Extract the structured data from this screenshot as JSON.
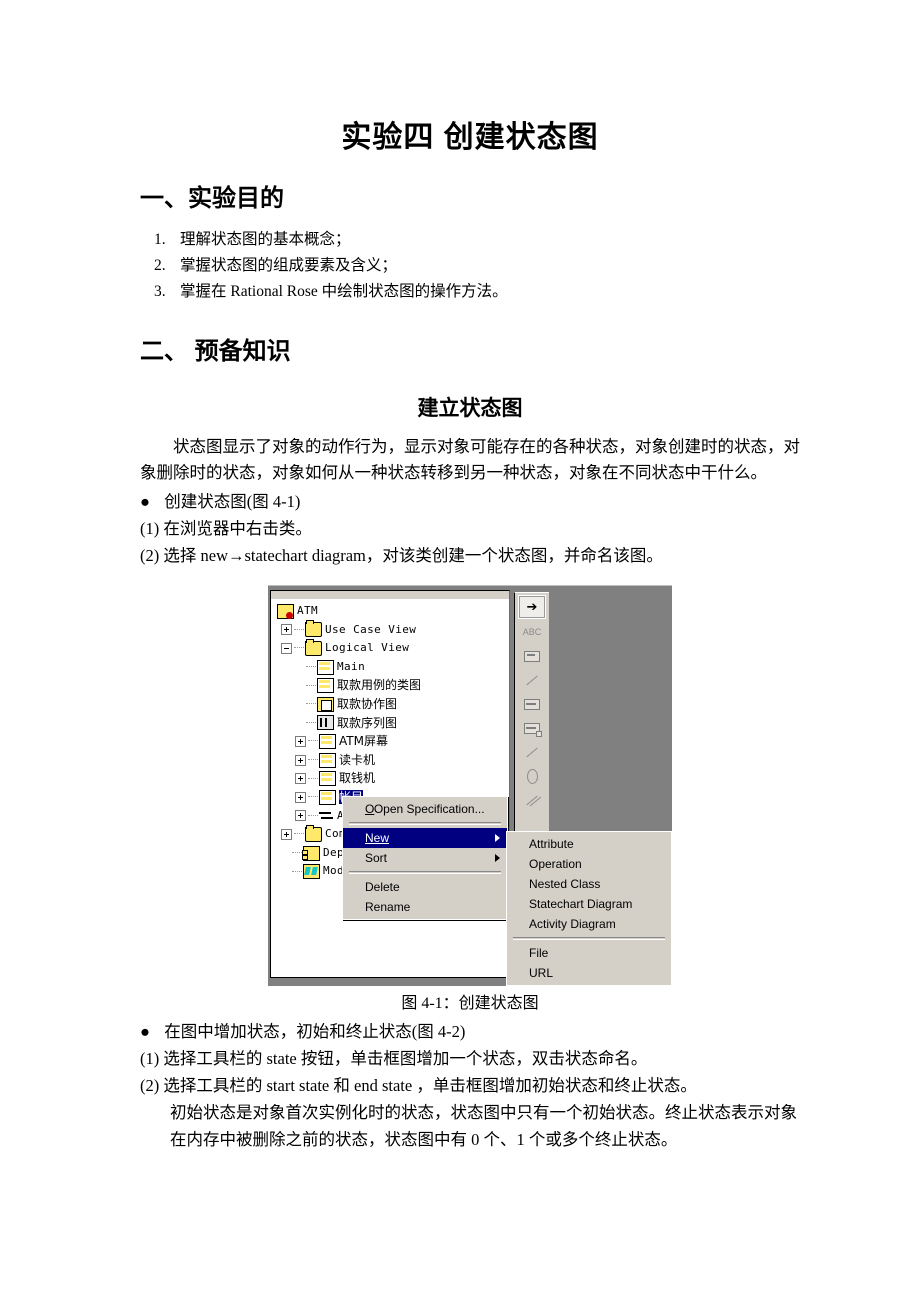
{
  "document": {
    "title": "实验四  创建状态图",
    "sections": [
      {
        "heading": "一、实验目的"
      },
      {
        "heading": "二、 预备知识"
      }
    ],
    "objectives": [
      {
        "num": "1.",
        "text": "理解状态图的基本概念；"
      },
      {
        "num": "2.",
        "text": "掌握状态图的组成要素及含义；"
      },
      {
        "num": "3.",
        "text": "掌握在 Rational Rose 中绘制状态图的操作方法。"
      }
    ],
    "subheading": "建立状态图",
    "paragraph": "状态图显示了对象的动作行为，显示对象可能存在的各种状态，对象创建时的状态，对象删除时的状态，对象如何从一种状态转移到另一种状态，对象在不同状态中干什么。",
    "bullet1": "创建状态图(图 4-1)",
    "step1_1": "(1) 在浏览器中右击类。",
    "step1_2": "(2) 选择 new→statechart diagram，对该类创建一个状态图，并命名该图。",
    "figure_caption": "图 4-1：创建状态图",
    "bullet2": "在图中增加状态，初始和终止状态(图 4-2)",
    "step2_1": "(1) 选择工具栏的 state 按钮，单击框图增加一个状态，双击状态命名。",
    "step2_2": "(2) 选择工具栏的 start state  和 end state  ，单击框图增加初始状态和终止状态。",
    "step2_2_cont": "初始状态是对象首次实例化时的状态，状态图中只有一个初始状态。终止状态表示对象在内存中被删除之前的状态，状态图中有 0 个、1 个或多个终止状态。"
  },
  "screenshot": {
    "tree": [
      {
        "label": "ATM",
        "depth": 0,
        "icon": "model-root-icon",
        "expander": "none",
        "cjk": false
      },
      {
        "label": "Use Case View",
        "depth": 1,
        "icon": "folder-icon",
        "expander": "plus",
        "cjk": false
      },
      {
        "label": "Logical View",
        "depth": 1,
        "icon": "folder-icon",
        "expander": "minus",
        "cjk": false
      },
      {
        "label": "Main",
        "depth": 2,
        "icon": "class-diagram-icon",
        "expander": "none",
        "cjk": false
      },
      {
        "label": "取款用例的类图",
        "depth": 2,
        "icon": "class-diagram-icon",
        "expander": "none",
        "cjk": true
      },
      {
        "label": "取款协作图",
        "depth": 2,
        "icon": "collaboration-diagram-icon",
        "expander": "none",
        "cjk": true
      },
      {
        "label": "取款序列图",
        "depth": 2,
        "icon": "sequence-diagram-icon",
        "expander": "none",
        "cjk": true
      },
      {
        "label": "ATM屏幕",
        "depth": 2,
        "icon": "class-icon",
        "expander": "plus",
        "cjk": true
      },
      {
        "label": "读卡机",
        "depth": 2,
        "icon": "class-icon",
        "expander": "plus",
        "cjk": true
      },
      {
        "label": "取钱机",
        "depth": 2,
        "icon": "class-icon",
        "expander": "plus",
        "cjk": true
      },
      {
        "label": "帐目",
        "depth": 2,
        "icon": "class-icon",
        "expander": "plus",
        "cjk": true,
        "selected": true
      },
      {
        "label": "A",
        "depth": 2,
        "icon": "association-icon",
        "expander": "plus",
        "cjk": false
      },
      {
        "label": "Comp",
        "depth": 1,
        "icon": "folder-icon",
        "expander": "plus",
        "cjk": false
      },
      {
        "label": "Depl",
        "depth": 1,
        "icon": "component-icon",
        "expander": "none",
        "cjk": false
      },
      {
        "label": "Mode",
        "depth": 1,
        "icon": "model-properties-icon",
        "expander": "none",
        "cjk": false
      }
    ],
    "toolbox": [
      {
        "name": "selection-tool",
        "glyph": "arrow",
        "active": true
      },
      {
        "name": "text-tool",
        "glyph": "ABC",
        "active": false
      },
      {
        "name": "note-tool",
        "glyph": "note",
        "active": false
      },
      {
        "name": "anchor-note-tool",
        "glyph": "line",
        "active": false
      },
      {
        "name": "state-tool",
        "glyph": "state",
        "active": false
      },
      {
        "name": "activity-tool",
        "glyph": "activity",
        "active": false
      },
      {
        "name": "transition-tool",
        "glyph": "line",
        "active": false
      },
      {
        "name": "start-state-tool",
        "glyph": "oval",
        "active": false
      },
      {
        "name": "end-state-tool",
        "glyph": "line2",
        "active": false
      }
    ],
    "context_menu": {
      "items": [
        {
          "label": "Open Specification...",
          "mnemonic": 0,
          "submenu": false,
          "highlighted": false
        },
        {
          "separator": true
        },
        {
          "label": "New",
          "mnemonic": 0,
          "submenu": true,
          "highlighted": true
        },
        {
          "label": "Sort",
          "mnemonic": 3,
          "submenu": true,
          "highlighted": false
        },
        {
          "separator": true
        },
        {
          "label": "Delete",
          "mnemonic": 0,
          "submenu": false,
          "highlighted": false
        },
        {
          "label": "Rename",
          "mnemonic": 4,
          "submenu": false,
          "highlighted": false
        }
      ]
    },
    "submenu": {
      "items": [
        {
          "label": "Attribute",
          "mnemonic": 0
        },
        {
          "label": "Operation",
          "mnemonic": 0
        },
        {
          "label": "Nested Class",
          "mnemonic": 7
        },
        {
          "label": "Statechart Diagram",
          "mnemonic": 5
        },
        {
          "label": "Activity Diagram",
          "mnemonic": 7
        },
        {
          "separator": true
        },
        {
          "label": "File",
          "mnemonic": 0
        },
        {
          "label": "URL",
          "mnemonic": 1
        }
      ]
    },
    "colors": {
      "menu_face": "#d4d0c8",
      "menu_highlight": "#000080",
      "canvas": "#808080",
      "folder": "#ffe96b",
      "selection": "#000080"
    }
  }
}
